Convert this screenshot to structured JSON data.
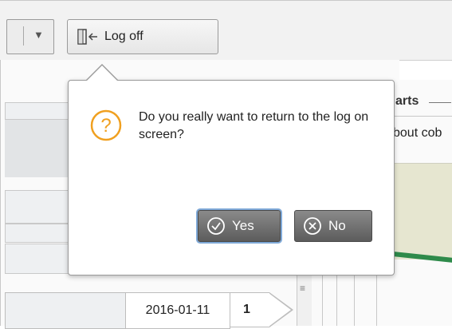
{
  "toolbar": {
    "dropdown_icon": "triangle-down-icon",
    "logoff": {
      "label": "Log off",
      "icon": "logout-door-icon"
    }
  },
  "background": {
    "panel_title_partial": "arts",
    "panel_subtitle_partial": "bout cob",
    "table_row": {
      "date": "2016-01-11",
      "count": "1"
    }
  },
  "dialog": {
    "icon": "question-circle-icon",
    "message": "Do you really want to return to the log on screen?",
    "yes": {
      "label": "Yes",
      "icon": "check-circle-icon"
    },
    "no": {
      "label": "No",
      "icon": "x-circle-icon"
    }
  },
  "colors": {
    "accent_question": "#f0a020",
    "button_gray": "#6e6e6e",
    "focus_ring": "#7fa9d8",
    "chart_green": "#2e8a4a"
  }
}
